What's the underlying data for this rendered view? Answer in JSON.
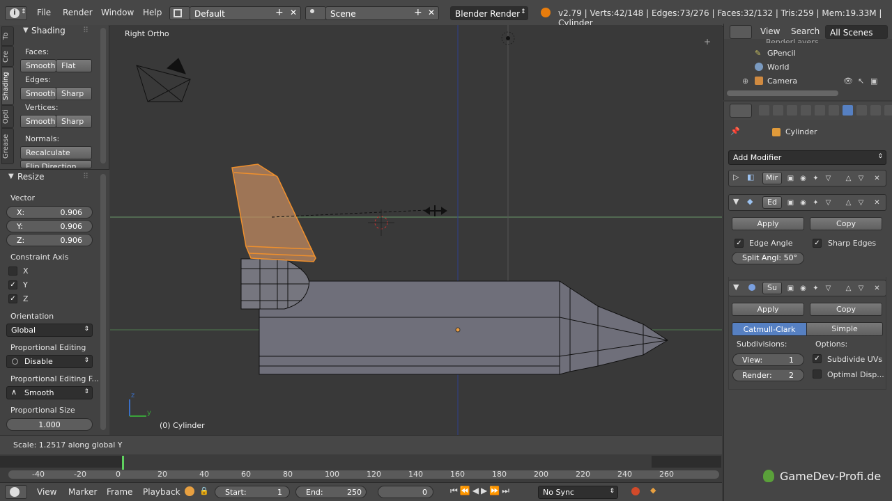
{
  "topbar": {
    "menus": [
      "File",
      "Render",
      "Window",
      "Help"
    ],
    "layout": "Default",
    "scene": "Scene",
    "engine": "Blender Render",
    "stats": "v2.79 | Verts:42/148 | Edges:73/276 | Faces:32/132 | Tris:259 | Mem:19.33M | Cylinder"
  },
  "toolpanel": {
    "tabs": [
      "To",
      "Cre",
      "Shading",
      "Opti",
      "Grease"
    ],
    "shading_title": "Shading",
    "faces_label": "Faces:",
    "edges_label": "Edges:",
    "vertices_label": "Vertices:",
    "normals_label": "Normals:",
    "smooth": "Smooth",
    "flat": "Flat",
    "sharp": "Sharp",
    "recalculate": "Recalculate",
    "flip_direction": "Flip Direction"
  },
  "resize": {
    "title": "Resize",
    "vector_label": "Vector",
    "x_label": "X:",
    "x": "0.906",
    "y_label": "Y:",
    "y": "0.906",
    "z_label": "Z:",
    "z": "0.906",
    "constraint_label": "Constraint Axis",
    "axis_x": "X",
    "axis_y": "Y",
    "axis_z": "Z",
    "axis_x_checked": false,
    "axis_y_checked": true,
    "axis_z_checked": true,
    "orientation_label": "Orientation",
    "orientation": "Global",
    "prop_edit_label": "Proportional Editing",
    "prop_edit": "Disable",
    "prop_falloff_label": "Proportional Editing F...",
    "prop_falloff": "Smooth",
    "prop_size_label": "Proportional Size",
    "prop_size": "1.000"
  },
  "viewport": {
    "view_name": "Right Ortho",
    "object_label": "(0) Cylinder",
    "axis_z": "z",
    "axis_y": "y"
  },
  "status": {
    "text": "Scale: 1.2517 along global Y"
  },
  "timeline": {
    "ticks": [
      "-40",
      "-20",
      "0",
      "20",
      "40",
      "60",
      "80",
      "100",
      "120",
      "140",
      "160",
      "180",
      "200",
      "220",
      "240",
      "260"
    ],
    "menus": [
      "View",
      "Marker",
      "Frame",
      "Playback"
    ],
    "start_label": "Start:",
    "start": "1",
    "end_label": "End:",
    "end": "250",
    "current": "0",
    "sync": "No Sync"
  },
  "outliner": {
    "menus": [
      "View",
      "Search"
    ],
    "filter": "All Scenes",
    "items": [
      "RenderLayers",
      "GPencil",
      "World",
      "Camera"
    ]
  },
  "properties": {
    "object_name": "Cylinder",
    "add_modifier": "Add Modifier",
    "mod1_name": "Mir",
    "mod2_name": "Ed",
    "mod3_name": "Su",
    "apply": "Apply",
    "copy": "Copy",
    "edge_angle": "Edge Angle",
    "sharp_edges": "Sharp Edges",
    "split_angle": "Split Angl: 50°",
    "catmull": "Catmull-Clark",
    "simple": "Simple",
    "subdivisions_label": "Subdivisions:",
    "options_label": "Options:",
    "view_label": "View:",
    "view_value": "1",
    "render_label": "Render:",
    "render_value": "2",
    "subdivide_uvs": "Subdivide UVs",
    "optimal_disp": "Optimal Disp..."
  },
  "watermark": "GameDev-Profi.de",
  "colors": {
    "selection": "#f0902c",
    "accent_blue": "#5680c2",
    "grid_green": "#5aa05a"
  }
}
